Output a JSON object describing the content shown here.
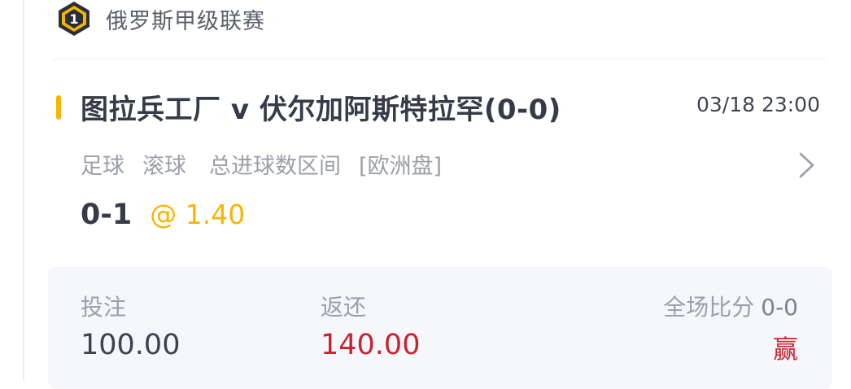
{
  "league": {
    "name": "俄罗斯甲级联赛",
    "badge_icon": "league-rank-1-badge",
    "badge_text": "1"
  },
  "match": {
    "title": "图拉兵工厂 v 伏尔加阿斯特拉罕(0-0)",
    "time": "03/18 23:00"
  },
  "tags": [
    "足球",
    "滚球",
    "总进球数区间",
    "[欧洲盘]"
  ],
  "pick": {
    "selection": "0-1",
    "odds": "@ 1.40"
  },
  "summary": {
    "stake_label": "投注",
    "stake_value": "100.00",
    "return_label": "返还",
    "return_value": "140.00",
    "fullscore_label": "全场比分",
    "fullscore_value": "0-0",
    "result": "赢"
  },
  "colors": {
    "accent": "#f7b500",
    "win": "#c9232f",
    "title": "#353b47",
    "muted": "#9b9fa8",
    "panel_bg": "#f6f7fa"
  }
}
